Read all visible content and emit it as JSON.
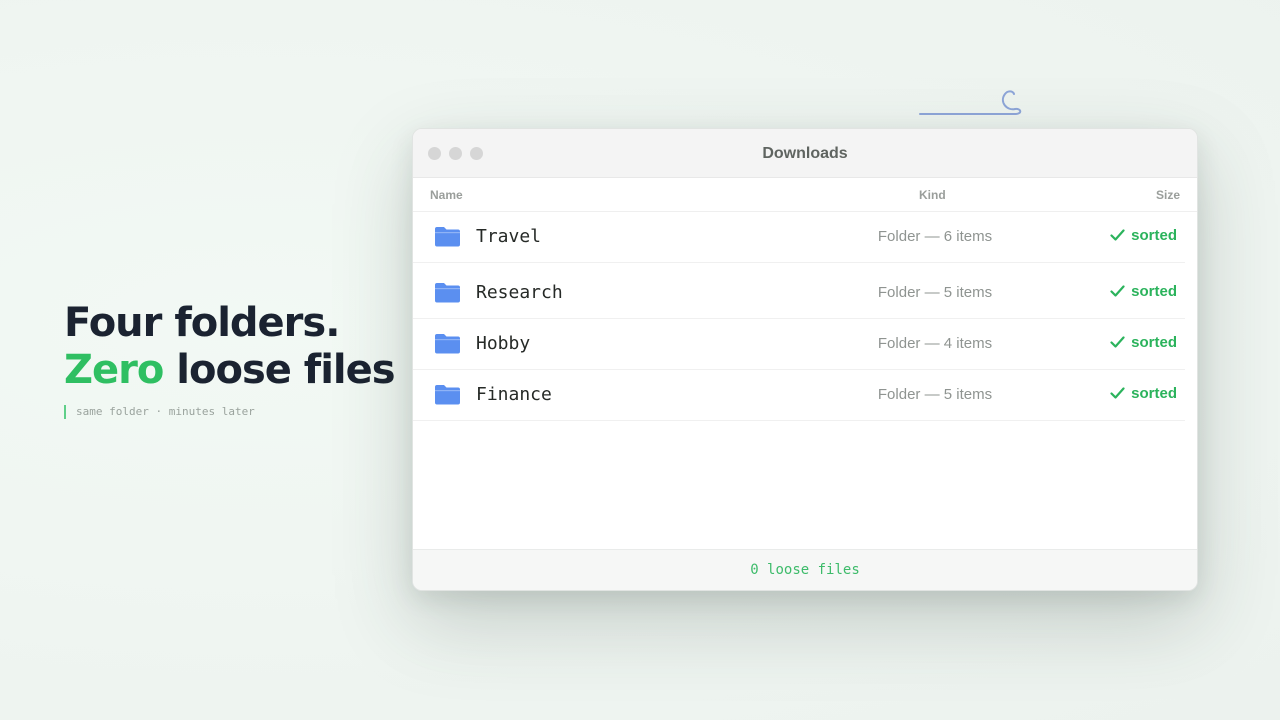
{
  "headline": {
    "line1": "Four folders.",
    "line2_accent": "Zero",
    "line2_rest": " loose files",
    "subline": "same folder · minutes later"
  },
  "window": {
    "title": "Downloads",
    "columns": {
      "name": "Name",
      "kind": "Kind",
      "size": "Size"
    },
    "rows": [
      {
        "name": "Travel",
        "kind": "Folder — 6 items",
        "status": "sorted",
        "icon": "folder-icon"
      },
      {
        "name": "Research",
        "kind": "Folder — 5 items",
        "status": "sorted",
        "icon": "folder-icon"
      },
      {
        "name": "Hobby",
        "kind": "Folder — 4 items",
        "status": "sorted",
        "icon": "folder-icon"
      },
      {
        "name": "Finance",
        "kind": "Folder — 5 items",
        "status": "sorted",
        "icon": "folder-icon"
      }
    ],
    "footer": "0 loose files"
  },
  "colors": {
    "accent": "#2fbf62",
    "folder": "#5b8ff0",
    "status": "#2bb35c"
  }
}
